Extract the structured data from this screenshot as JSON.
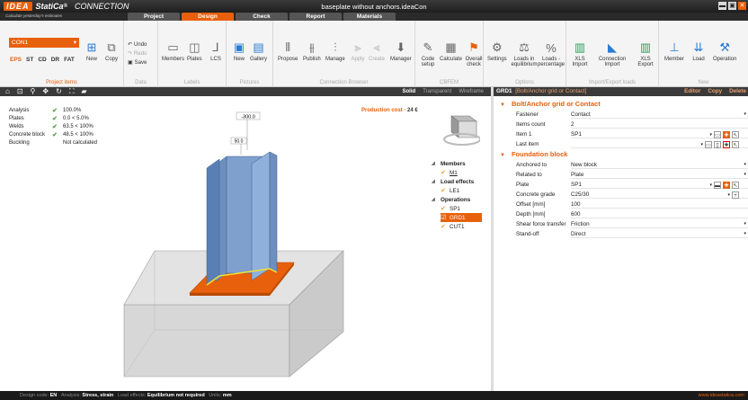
{
  "app": {
    "brand": "IDEA",
    "product": "StatiCa",
    "module": "CONNECTION",
    "tagline": "Calculate yesterday's estimates",
    "file": "baseplate without anchors.ideaCon",
    "win_min": "▬",
    "win_max": "▣",
    "win_close": "✕"
  },
  "tabs": [
    "Project",
    "Design",
    "Check",
    "Report",
    "Materials"
  ],
  "active_tab": "Design",
  "ribbon": {
    "condition": "CON1",
    "types": [
      "EPS",
      "ST",
      "CD",
      "DR",
      "FAT"
    ],
    "new": "New",
    "copy": "Copy",
    "project_items": "Project items",
    "undo": "Undo",
    "redo": "Redo",
    "save": "Save",
    "data": "Data",
    "members": "Members",
    "plates": "Plates",
    "lcs": "LCS",
    "labels": "Labels",
    "new2": "New",
    "gallery": "Gallery",
    "pictures": "Pictures",
    "propose": "Propose",
    "publish": "Publish",
    "manage": "Manage",
    "apply": "Apply",
    "create": "Create",
    "manager": "Manager",
    "conn_browser": "Connection Browser",
    "code_setup": "Code setup",
    "calculate": "Calculate",
    "overall_check": "Overall check",
    "cbfem": "CBFEM",
    "settings": "Settings",
    "loads_eq": "Loads in equilibrium",
    "loads_pct": "Loads - percentage",
    "options": "Options",
    "xls_import": "XLS Import",
    "conn_import": "Connection Import",
    "xls_export": "XLS Export",
    "import_export": "Import/Export loads",
    "member": "Member",
    "load": "Load",
    "operation": "Operation",
    "new3": "New"
  },
  "view": {
    "modes": [
      "Solid",
      "Transparent",
      "Wireframe"
    ],
    "selected": "Solid"
  },
  "results": [
    {
      "label": "Analysis",
      "ok": true,
      "value": "100.0%"
    },
    {
      "label": "Plates",
      "ok": true,
      "value": "0.0 < 5.0%"
    },
    {
      "label": "Welds",
      "ok": true,
      "value": "63.5 < 100%"
    },
    {
      "label": "Concrete block",
      "ok": true,
      "value": "48.5 < 100%"
    },
    {
      "label": "Buckling",
      "ok": false,
      "value": "Not calculated"
    }
  ],
  "production_cost_label": "Production cost",
  "production_cost": "24 €",
  "dims": {
    "d1": "-300.0",
    "d2": "50.0"
  },
  "tree": {
    "members": "Members",
    "m1": "M1",
    "load_effects": "Load effects",
    "le1": "LE1",
    "operations": "Operations",
    "sp1": "SP1",
    "grd1": "GRD1",
    "cut1": "CUT1"
  },
  "panel": {
    "id": "GRD1",
    "title": "[Bolt/Anchor grid or Contact]",
    "editor": "Editor",
    "copy": "Copy",
    "delete": "Delete",
    "sec1": "Bolt/Anchor grid or Contact",
    "fastener_k": "Fastener",
    "fastener_v": "Contact",
    "items_k": "Items count",
    "items_v": "2",
    "item1_k": "Item 1",
    "item1_v": "SP1",
    "last_k": "Last item",
    "last_v": "",
    "sec2": "Foundation block",
    "anch_k": "Anchored to",
    "anch_v": "New block",
    "rel_k": "Related to",
    "rel_v": "Plate",
    "plate_k": "Plate",
    "plate_v": "SP1",
    "cg_k": "Concrete grade",
    "cg_v": "C25/30",
    "off_k": "Offset [mm]",
    "off_v": "100",
    "dep_k": "Depth [mm]",
    "dep_v": "600",
    "sft_k": "Shear force transfer",
    "sft_v": "Friction",
    "so_k": "Stand-off",
    "so_v": "Direct"
  },
  "status": {
    "dc_label": "Design code:",
    "dc": "EN",
    "an_label": "Analysis:",
    "an": "Stress, strain",
    "le_label": "Load effects:",
    "le": "Equilibrium not required",
    "un_label": "Units:",
    "un": "mm",
    "url": "www.ideastatica.com"
  }
}
